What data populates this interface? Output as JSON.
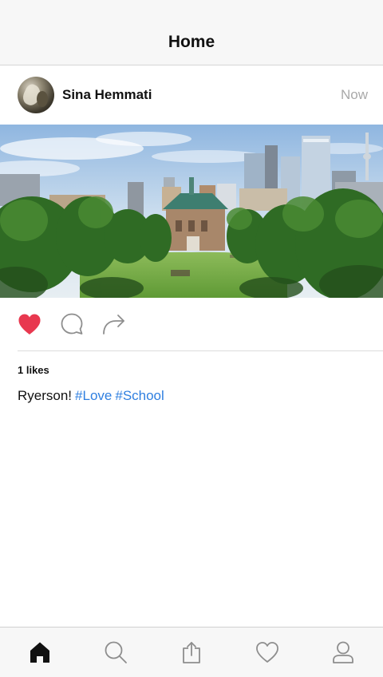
{
  "header": {
    "title": "Home"
  },
  "post": {
    "author": "Sina Hemmati",
    "timestamp": "Now",
    "likes_text": "1 likes",
    "caption_text": "Ryerson!",
    "hashtags": [
      "#Love",
      "#School"
    ],
    "liked": true
  },
  "actions": [
    {
      "icon": "heart-filled-icon"
    },
    {
      "icon": "comment-icon"
    },
    {
      "icon": "share-arrow-icon"
    }
  ],
  "tabbar": [
    {
      "icon": "home-icon",
      "active": true
    },
    {
      "icon": "search-icon",
      "active": false
    },
    {
      "icon": "upload-icon",
      "active": false
    },
    {
      "icon": "heart-icon",
      "active": false
    },
    {
      "icon": "profile-icon",
      "active": false
    }
  ],
  "colors": {
    "like_red": "#e8384f",
    "hashtag_blue": "#2f7fe0",
    "muted_gray": "#a9a9a9",
    "icon_gray": "#8e8e8e"
  }
}
